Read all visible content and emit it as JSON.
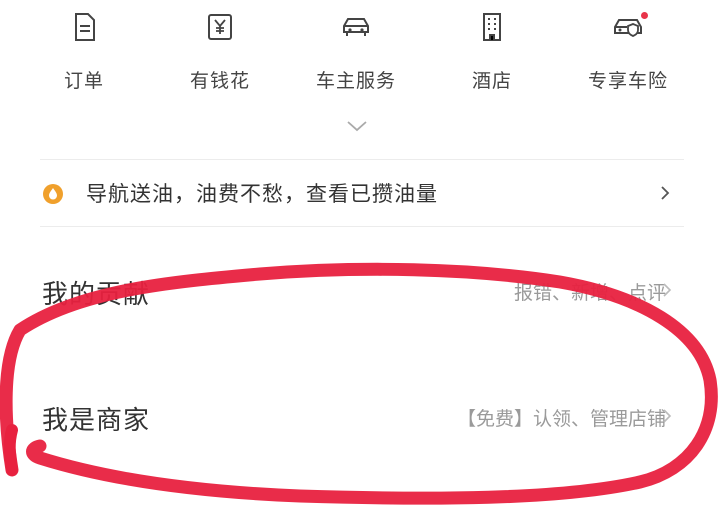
{
  "grid": {
    "items": [
      {
        "label": "订单",
        "icon": "order-document-icon"
      },
      {
        "label": "有钱花",
        "icon": "yuan-card-icon"
      },
      {
        "label": "车主服务",
        "icon": "car-icon"
      },
      {
        "label": "酒店",
        "icon": "hotel-building-icon"
      },
      {
        "label": "专享车险",
        "icon": "car-insurance-icon",
        "badge": true
      }
    ]
  },
  "banner": {
    "text": "导航送油，油费不愁，查看已攒油量",
    "icon": "fuel-drop-icon"
  },
  "rows": [
    {
      "title": "我的贡献",
      "hint": "报错、新增、点评"
    },
    {
      "title": "我是商家",
      "hint": "【免费】认领、管理店铺"
    }
  ],
  "colors": {
    "badge": "#e8344a",
    "fuel": "#f0a02c",
    "annotation": "#e8213f"
  }
}
